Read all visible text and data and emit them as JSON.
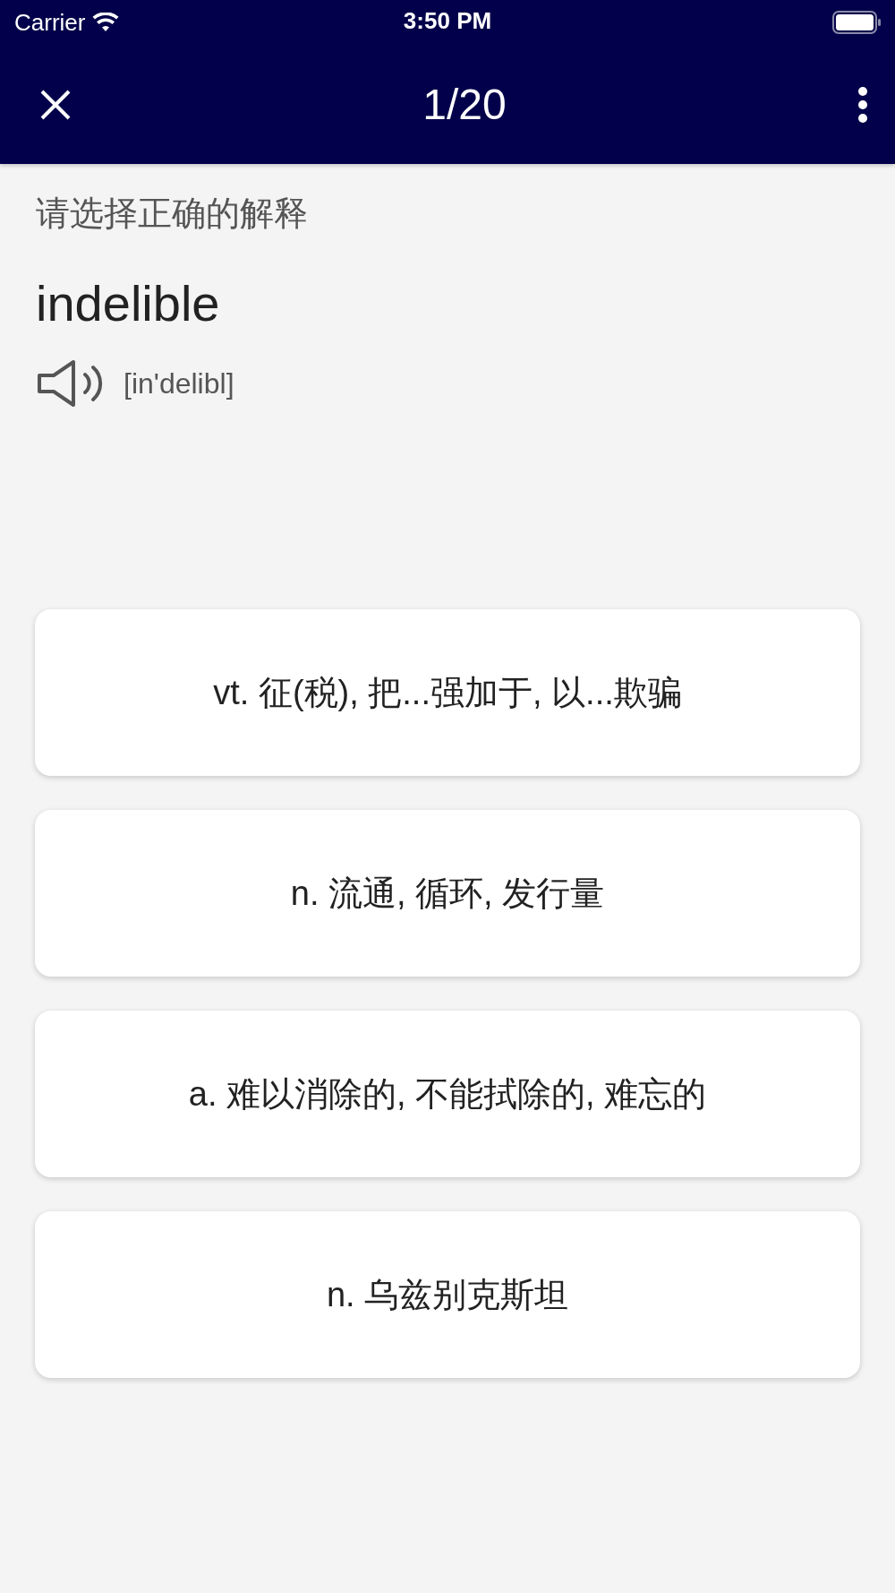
{
  "status_bar": {
    "carrier": "Carrier",
    "time": "3:50 PM"
  },
  "nav_bar": {
    "title": "1/20"
  },
  "question": {
    "instruction": "请选择正确的解释",
    "word": "indelible",
    "phonetic": "[in'delibl]"
  },
  "options": [
    {
      "text": "vt. 征(税), 把...强加于, 以...欺骗"
    },
    {
      "text": "n. 流通, 循环, 发行量"
    },
    {
      "text": "a. 难以消除的, 不能拭除的, 难忘的"
    },
    {
      "text": "n. 乌兹别克斯坦"
    }
  ]
}
